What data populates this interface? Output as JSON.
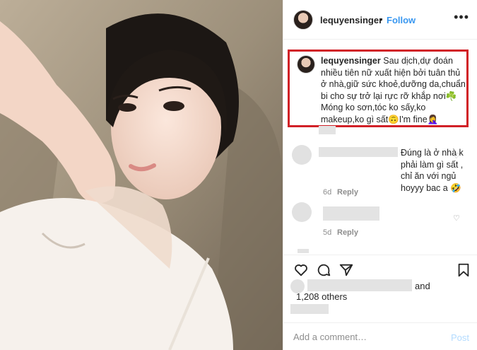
{
  "post": {
    "username": "lequyensinger",
    "separator": "•",
    "follow_label": "Follow",
    "more_icon": "more-horizontal-icon"
  },
  "caption": {
    "username": "lequyensinger",
    "text": "Sau dịch,dự đoán nhiều tiên nữ xuất hiện bởi tuân thủ ở nhà,giữ sức khoẻ,dưỡng da,chuẩn bi cho sự trở lại rực rỡ khắp nơi☘️ Móng ko sơn,tóc ko sấy,ko makeup,ko gì sất🙃I'm fine🤦‍♀️",
    "highlight_color": "#d12027"
  },
  "comments": [
    {
      "text": "Đúng là ở nhà k phải làm gì sất , chỉ ăn với ngủ hoyyy bac a 🤣",
      "age": "6d",
      "reply_label": "Reply"
    },
    {
      "text": "",
      "age": "5d",
      "reply_label": "Reply"
    }
  ],
  "actions": {
    "like_icon": "heart-icon",
    "comment_icon": "comment-icon",
    "share_icon": "share-icon",
    "save_icon": "bookmark-icon"
  },
  "likes": {
    "and_label": "and",
    "others_label": "1,208 others"
  },
  "add_comment": {
    "placeholder": "Add a comment…",
    "post_label": "Post"
  },
  "colors": {
    "link_blue": "#3897f0",
    "post_disabled": "#b3dbff",
    "secondary_text": "#8e8e8e"
  }
}
